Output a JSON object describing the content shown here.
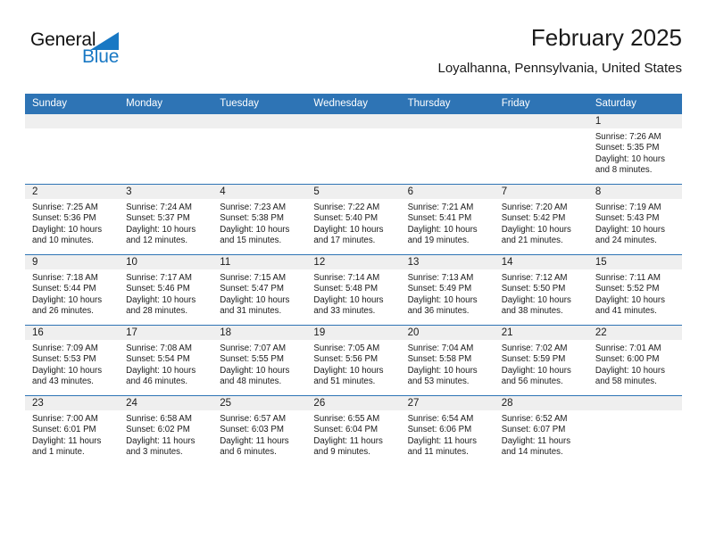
{
  "brand": {
    "general": "General",
    "blue": "Blue",
    "triangle_color": "#1878C4",
    "general_color": "#111111",
    "blue_color": "#1878C4"
  },
  "header": {
    "title": "February 2025",
    "subtitle": "Loyalhanna, Pennsylvania, United States",
    "header_bg": "#2E74B5",
    "header_text_color": "#FFFFFF",
    "daynum_bg": "#EFEFEF"
  },
  "weekdays": [
    "Sunday",
    "Monday",
    "Tuesday",
    "Wednesday",
    "Thursday",
    "Friday",
    "Saturday"
  ],
  "weeks": [
    [
      {
        "day": "",
        "sunrise": "",
        "sunset": "",
        "daylight": "",
        "empty": true
      },
      {
        "day": "",
        "sunrise": "",
        "sunset": "",
        "daylight": "",
        "empty": true
      },
      {
        "day": "",
        "sunrise": "",
        "sunset": "",
        "daylight": "",
        "empty": true
      },
      {
        "day": "",
        "sunrise": "",
        "sunset": "",
        "daylight": "",
        "empty": true
      },
      {
        "day": "",
        "sunrise": "",
        "sunset": "",
        "daylight": "",
        "empty": true
      },
      {
        "day": "",
        "sunrise": "",
        "sunset": "",
        "daylight": "",
        "empty": true
      },
      {
        "day": "1",
        "sunrise": "Sunrise: 7:26 AM",
        "sunset": "Sunset: 5:35 PM",
        "daylight": "Daylight: 10 hours and 8 minutes."
      }
    ],
    [
      {
        "day": "2",
        "sunrise": "Sunrise: 7:25 AM",
        "sunset": "Sunset: 5:36 PM",
        "daylight": "Daylight: 10 hours and 10 minutes."
      },
      {
        "day": "3",
        "sunrise": "Sunrise: 7:24 AM",
        "sunset": "Sunset: 5:37 PM",
        "daylight": "Daylight: 10 hours and 12 minutes."
      },
      {
        "day": "4",
        "sunrise": "Sunrise: 7:23 AM",
        "sunset": "Sunset: 5:38 PM",
        "daylight": "Daylight: 10 hours and 15 minutes."
      },
      {
        "day": "5",
        "sunrise": "Sunrise: 7:22 AM",
        "sunset": "Sunset: 5:40 PM",
        "daylight": "Daylight: 10 hours and 17 minutes."
      },
      {
        "day": "6",
        "sunrise": "Sunrise: 7:21 AM",
        "sunset": "Sunset: 5:41 PM",
        "daylight": "Daylight: 10 hours and 19 minutes."
      },
      {
        "day": "7",
        "sunrise": "Sunrise: 7:20 AM",
        "sunset": "Sunset: 5:42 PM",
        "daylight": "Daylight: 10 hours and 21 minutes."
      },
      {
        "day": "8",
        "sunrise": "Sunrise: 7:19 AM",
        "sunset": "Sunset: 5:43 PM",
        "daylight": "Daylight: 10 hours and 24 minutes."
      }
    ],
    [
      {
        "day": "9",
        "sunrise": "Sunrise: 7:18 AM",
        "sunset": "Sunset: 5:44 PM",
        "daylight": "Daylight: 10 hours and 26 minutes."
      },
      {
        "day": "10",
        "sunrise": "Sunrise: 7:17 AM",
        "sunset": "Sunset: 5:46 PM",
        "daylight": "Daylight: 10 hours and 28 minutes."
      },
      {
        "day": "11",
        "sunrise": "Sunrise: 7:15 AM",
        "sunset": "Sunset: 5:47 PM",
        "daylight": "Daylight: 10 hours and 31 minutes."
      },
      {
        "day": "12",
        "sunrise": "Sunrise: 7:14 AM",
        "sunset": "Sunset: 5:48 PM",
        "daylight": "Daylight: 10 hours and 33 minutes."
      },
      {
        "day": "13",
        "sunrise": "Sunrise: 7:13 AM",
        "sunset": "Sunset: 5:49 PM",
        "daylight": "Daylight: 10 hours and 36 minutes."
      },
      {
        "day": "14",
        "sunrise": "Sunrise: 7:12 AM",
        "sunset": "Sunset: 5:50 PM",
        "daylight": "Daylight: 10 hours and 38 minutes."
      },
      {
        "day": "15",
        "sunrise": "Sunrise: 7:11 AM",
        "sunset": "Sunset: 5:52 PM",
        "daylight": "Daylight: 10 hours and 41 minutes."
      }
    ],
    [
      {
        "day": "16",
        "sunrise": "Sunrise: 7:09 AM",
        "sunset": "Sunset: 5:53 PM",
        "daylight": "Daylight: 10 hours and 43 minutes."
      },
      {
        "day": "17",
        "sunrise": "Sunrise: 7:08 AM",
        "sunset": "Sunset: 5:54 PM",
        "daylight": "Daylight: 10 hours and 46 minutes."
      },
      {
        "day": "18",
        "sunrise": "Sunrise: 7:07 AM",
        "sunset": "Sunset: 5:55 PM",
        "daylight": "Daylight: 10 hours and 48 minutes."
      },
      {
        "day": "19",
        "sunrise": "Sunrise: 7:05 AM",
        "sunset": "Sunset: 5:56 PM",
        "daylight": "Daylight: 10 hours and 51 minutes."
      },
      {
        "day": "20",
        "sunrise": "Sunrise: 7:04 AM",
        "sunset": "Sunset: 5:58 PM",
        "daylight": "Daylight: 10 hours and 53 minutes."
      },
      {
        "day": "21",
        "sunrise": "Sunrise: 7:02 AM",
        "sunset": "Sunset: 5:59 PM",
        "daylight": "Daylight: 10 hours and 56 minutes."
      },
      {
        "day": "22",
        "sunrise": "Sunrise: 7:01 AM",
        "sunset": "Sunset: 6:00 PM",
        "daylight": "Daylight: 10 hours and 58 minutes."
      }
    ],
    [
      {
        "day": "23",
        "sunrise": "Sunrise: 7:00 AM",
        "sunset": "Sunset: 6:01 PM",
        "daylight": "Daylight: 11 hours and 1 minute."
      },
      {
        "day": "24",
        "sunrise": "Sunrise: 6:58 AM",
        "sunset": "Sunset: 6:02 PM",
        "daylight": "Daylight: 11 hours and 3 minutes."
      },
      {
        "day": "25",
        "sunrise": "Sunrise: 6:57 AM",
        "sunset": "Sunset: 6:03 PM",
        "daylight": "Daylight: 11 hours and 6 minutes."
      },
      {
        "day": "26",
        "sunrise": "Sunrise: 6:55 AM",
        "sunset": "Sunset: 6:04 PM",
        "daylight": "Daylight: 11 hours and 9 minutes."
      },
      {
        "day": "27",
        "sunrise": "Sunrise: 6:54 AM",
        "sunset": "Sunset: 6:06 PM",
        "daylight": "Daylight: 11 hours and 11 minutes."
      },
      {
        "day": "28",
        "sunrise": "Sunrise: 6:52 AM",
        "sunset": "Sunset: 6:07 PM",
        "daylight": "Daylight: 11 hours and 14 minutes."
      },
      {
        "day": "",
        "sunrise": "",
        "sunset": "",
        "daylight": "",
        "empty": true
      }
    ]
  ]
}
